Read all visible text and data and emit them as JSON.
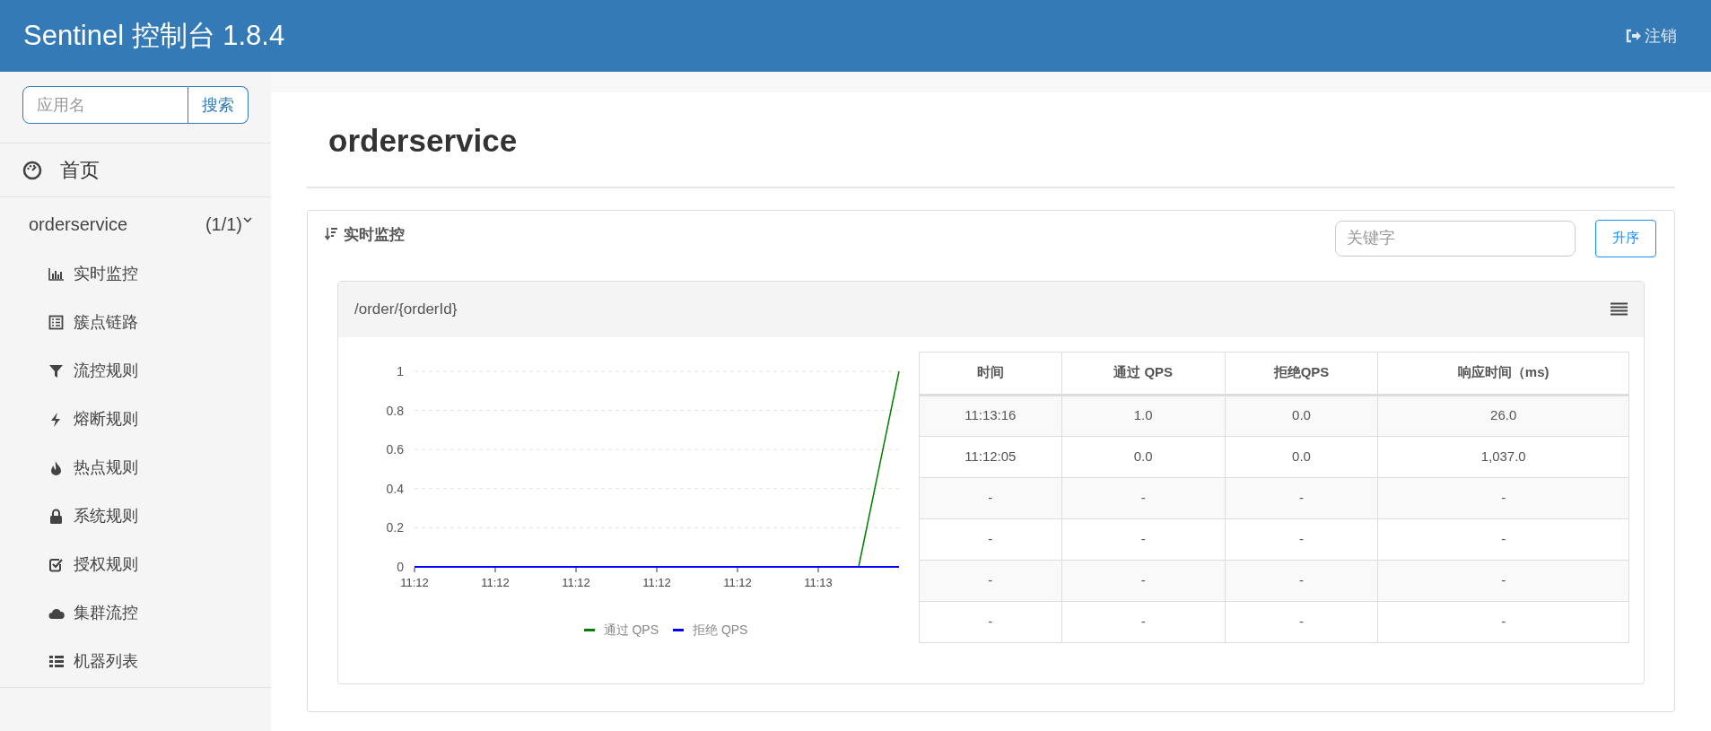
{
  "header": {
    "title": "Sentinel 控制台 1.8.4",
    "logout": "注销"
  },
  "sidebar": {
    "search": {
      "placeholder": "应用名",
      "button": "搜索"
    },
    "home": "首页",
    "app": {
      "name": "orderservice",
      "count": "(1/1)",
      "expanded": true,
      "items": [
        "实时监控",
        "簇点链路",
        "流控规则",
        "熔断规则",
        "热点规则",
        "系统规则",
        "授权规则",
        "集群流控",
        "机器列表"
      ]
    }
  },
  "main": {
    "title": "orderservice",
    "panel": {
      "title": "实时监控",
      "keyword_placeholder": "关键字",
      "sort_button": "升序",
      "resource": {
        "name": "/order/{orderId}",
        "chart_data": {
          "type": "line",
          "categories": [
            "11:12",
            null,
            "11:12",
            null,
            "11:12",
            null,
            "11:12",
            null,
            "11:12",
            null,
            "11:13",
            null,
            null
          ],
          "yticks": [
            0,
            0.2,
            0.4,
            0.6,
            0.8,
            1
          ],
          "ylim": [
            0,
            1
          ],
          "grid": true,
          "series": [
            {
              "name": "通过 QPS",
              "color": "#008000",
              "values": [
                null,
                null,
                null,
                null,
                null,
                null,
                null,
                null,
                null,
                null,
                null,
                0,
                1
              ]
            },
            {
              "name": "拒绝 QPS",
              "color": "#0000ff",
              "values": [
                0,
                0,
                0,
                0,
                0,
                0,
                0,
                0,
                0,
                0,
                0,
                0,
                0
              ]
            }
          ]
        },
        "table": {
          "columns": [
            "时间",
            "通过 QPS",
            "拒绝QPS",
            "响应时间（ms)"
          ],
          "rows": [
            [
              "11:13:16",
              "1.0",
              "0.0",
              "26.0"
            ],
            [
              "11:12:05",
              "0.0",
              "0.0",
              "1,037.0"
            ],
            [
              "-",
              "-",
              "-",
              "-"
            ],
            [
              "-",
              "-",
              "-",
              "-"
            ],
            [
              "-",
              "-",
              "-",
              "-"
            ],
            [
              "-",
              "-",
              "-",
              "-"
            ]
          ]
        }
      }
    }
  }
}
